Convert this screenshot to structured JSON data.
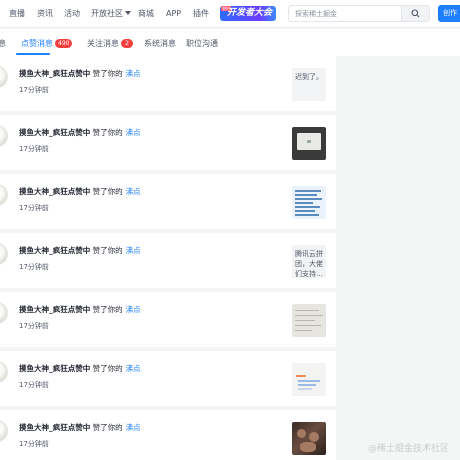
{
  "nav": {
    "items": [
      {
        "label": "直播"
      },
      {
        "label": "资讯"
      },
      {
        "label": "活动"
      },
      {
        "label": "开放社区"
      },
      {
        "label": "商城"
      },
      {
        "label": "APP"
      },
      {
        "label": "插件"
      }
    ],
    "banner": {
      "tag": "限时",
      "text": "开发者大会"
    },
    "search_placeholder": "探索稀土掘金",
    "create_label": "创作"
  },
  "tabs": [
    {
      "label": "评论消息",
      "visible": "息"
    },
    {
      "label": "点赞消息",
      "badge": "490",
      "active": true
    },
    {
      "label": "关注消息",
      "badge": "2"
    },
    {
      "label": "系统消息"
    },
    {
      "label": "职位沟通"
    }
  ],
  "notifications": [
    {
      "user": "摸鱼大神_疯狂点赞中",
      "action": "赞了你的",
      "target": "沸点",
      "time": "17分钟前",
      "thumb": {
        "kind": "text",
        "text": "迟到了。"
      }
    },
    {
      "user": "摸鱼大神_疯狂点赞中",
      "action": "赞了你的",
      "target": "沸点",
      "time": "17分钟前",
      "thumb": {
        "kind": "image",
        "icon": "monitor-photo"
      }
    },
    {
      "user": "摸鱼大神_疯狂点赞中",
      "action": "赞了你的",
      "target": "沸点",
      "time": "17分钟前",
      "thumb": {
        "kind": "image",
        "icon": "document-screenshot"
      }
    },
    {
      "user": "摸鱼大神_疯狂点赞中",
      "action": "赞了你的",
      "target": "沸点",
      "time": "17分钟前",
      "thumb": {
        "kind": "text",
        "text": "腾讯云拼团，大佬们支持…"
      }
    },
    {
      "user": "摸鱼大神_疯狂点赞中",
      "action": "赞了你的",
      "target": "沸点",
      "time": "17分钟前",
      "thumb": {
        "kind": "image",
        "icon": "paper-photo"
      }
    },
    {
      "user": "摸鱼大神_疯狂点赞中",
      "action": "赞了你的",
      "target": "沸点",
      "time": "17分钟前",
      "thumb": {
        "kind": "image",
        "icon": "chart-screenshot"
      }
    },
    {
      "user": "摸鱼大神_疯狂点赞中",
      "action": "赞了你的",
      "target": "沸点",
      "time": "17分钟前",
      "thumb": {
        "kind": "image",
        "icon": "people-photo"
      }
    }
  ],
  "watermark": "@稀土掘金技术社区",
  "colors": {
    "accent": "#1e80ff",
    "badge": "#f53f3f",
    "background": "#f4f5f5"
  }
}
